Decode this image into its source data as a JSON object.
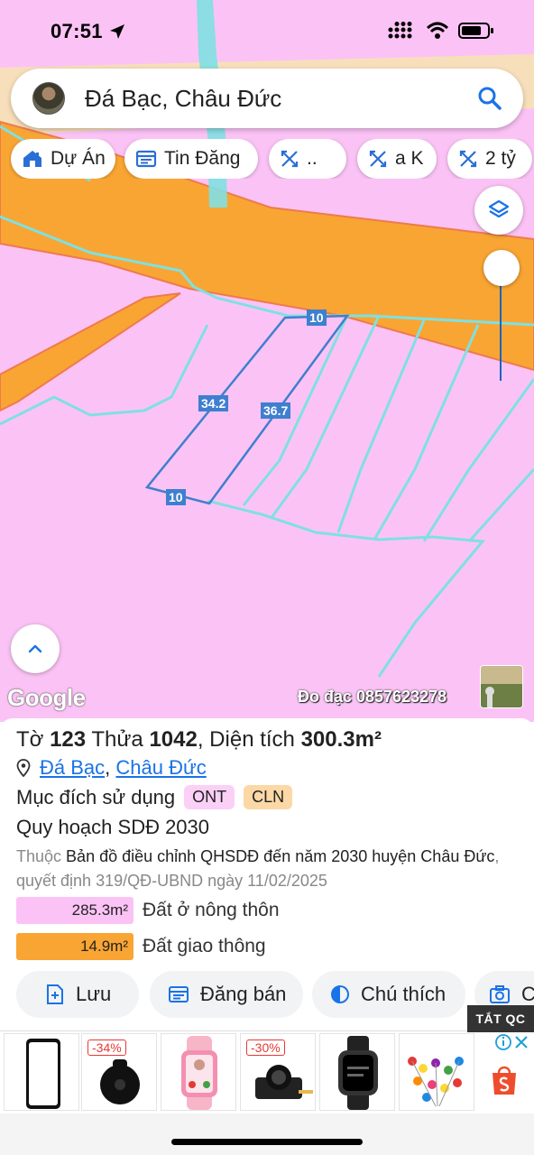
{
  "status_bar": {
    "time": "07:51"
  },
  "search": {
    "text": "Đá Bạc, Châu Đức"
  },
  "chips": [
    {
      "label": "Dự Án",
      "icon": "home-icon"
    },
    {
      "label": "Tin Đăng",
      "icon": "listing-icon"
    },
    {
      "label": "..",
      "icon": "ruler-icon"
    },
    {
      "label": "a K",
      "icon": "ruler-icon"
    },
    {
      "label": "2 tỷ",
      "icon": "ruler-icon"
    }
  ],
  "map": {
    "segment_labels": [
      "10",
      "34.2",
      "36.7",
      "10"
    ],
    "google": "Google",
    "surveyor": "Đo đạc 0857623278"
  },
  "parcel": {
    "to_label": "Tờ",
    "to_value": "123",
    "thua_label": "Thửa",
    "thua_value": "1042",
    "area_label": ", Diện tích",
    "area_value": "300.3m²",
    "commune": "Đá Bạc",
    "separator": ",",
    "district": "Châu Đức",
    "purpose_label": "Mục đích sử dụng",
    "purpose_codes": [
      "ONT",
      "CLN"
    ],
    "plan_title": "Quy hoạch SDĐ 2030",
    "plan_prefix": "Thuộc",
    "plan_map": "Bản đồ điều chỉnh QHSDĐ đến năm 2030 huyện Châu Đức",
    "plan_suffix": ", quyết định 319/QĐ-UBND ngày 11/02/2025",
    "legend": [
      {
        "area": "285.3m²",
        "label": "Đất ở nông thôn",
        "color": "#fbc3f5"
      },
      {
        "area": "14.9m²",
        "label": "Đất giao thông",
        "color": "#f9a533"
      }
    ]
  },
  "actions": [
    {
      "label": "Lưu",
      "icon": "save-icon"
    },
    {
      "label": "Đăng bán",
      "icon": "post-icon"
    },
    {
      "label": "Chú thích",
      "icon": "legend-icon"
    },
    {
      "label": "C",
      "icon": "camera-icon"
    }
  ],
  "ads": {
    "close_label": "TẮT QC",
    "items": [
      {
        "discount": ""
      },
      {
        "discount": "-34%"
      },
      {
        "discount": ""
      },
      {
        "discount": "-30%"
      },
      {
        "discount": ""
      },
      {
        "discount": ""
      }
    ]
  },
  "colors": {
    "pink_zone": "#fbc3f5",
    "road": "#f9a533",
    "boundary": "#7fe0e2",
    "parcel_line": "#3f7fcf",
    "link": "#1a73e8"
  }
}
